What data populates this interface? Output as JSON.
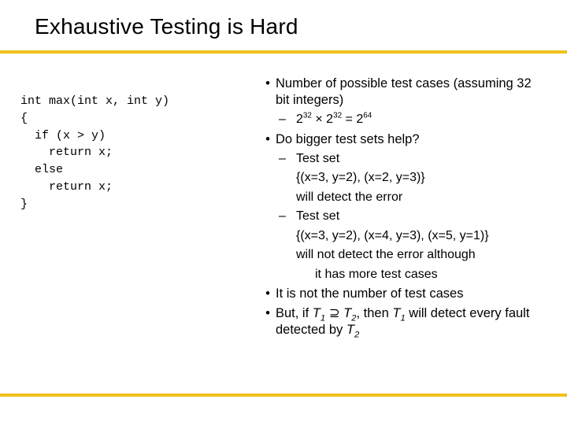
{
  "title": "Exhaustive Testing is Hard",
  "code": "int max(int x, int y)\n{\n  if (x > y)\n    return x;\n  else\n    return x;\n}",
  "bullets": {
    "b1": "Number of possible test cases (assuming 32 bit integers)",
    "b1a_pre": "2",
    "b1a_e1": "32",
    "b1a_mid": " × 2",
    "b1a_e2": "32",
    "b1a_eq": " = 2",
    "b1a_e3": "64",
    "b2": "Do bigger test sets help?",
    "b2a": "Test set",
    "b2a_cont1": "{(x=3, y=2), (x=2, y=3)}",
    "b2a_cont2": "will detect the error",
    "b2b": "Test set",
    "b2b_cont1": "{(x=3, y=2), (x=4, y=3), (x=5, y=1)}",
    "b2b_cont2": "will not detect the error although",
    "b2b_cont3": "it has more test cases",
    "b3": "It is not the number of test cases",
    "b4_pre": "But, if ",
    "b4_t1": "T",
    "b4_s1": "1",
    "b4_sup": " ⊇ ",
    "b4_t2": "T",
    "b4_s2": "2",
    "b4_mid": ", then ",
    "b4_t3": "T",
    "b4_s3": "1",
    "b4_post1": " will detect every fault detected by ",
    "b4_t4": "T",
    "b4_s4": "2"
  }
}
